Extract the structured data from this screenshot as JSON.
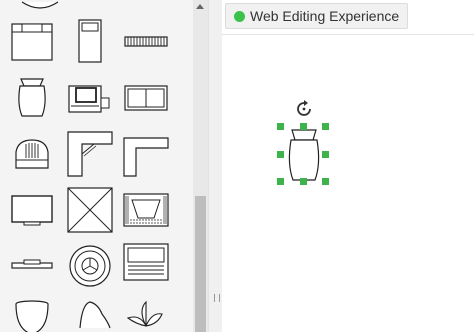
{
  "status": {
    "label": "Web Editing Experience",
    "color": "#3cc24a"
  },
  "palette": {
    "shapes": [
      "desk-shape",
      "twin-bed-shape",
      "radiator-shape",
      "armchair-shape",
      "office-desk-shape",
      "sofa-shape",
      "lounge-chair-shape",
      "corner-desk-shape",
      "l-shaped-counter-shape",
      "tv-stand-shape",
      "crossed-box-shape",
      "fireplace-shape",
      "slim-shelf-shape",
      "round-table-shape",
      "piano-shape",
      "round-stool-shape",
      "chair-back-shape",
      "plant-shape"
    ]
  },
  "selection": {
    "shape": "armchair-shape",
    "handle_color": "#3cb44b"
  }
}
